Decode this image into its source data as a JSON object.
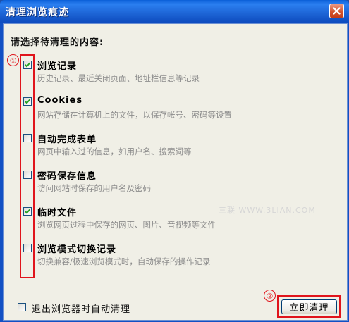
{
  "window": {
    "title": "清理浏览痕迹"
  },
  "heading": "请选择待清理的内容:",
  "items": [
    {
      "title": "浏览记录",
      "desc": "历史记录、最近关闭页面、地址栏信息等记录",
      "checked": true
    },
    {
      "title": "Cookies",
      "desc": "网站存储在计算机上的文件，以保存帐号、密码等设置",
      "checked": true
    },
    {
      "title": "自动完成表单",
      "desc": "网页中输入过的信息，如用户名、搜索词等",
      "checked": false
    },
    {
      "title": "密码保存信息",
      "desc": "访问网站时保存的用户名及密码",
      "checked": false
    },
    {
      "title": "临时文件",
      "desc": "浏览网页过程中保存的网页、图片、音视频等文件",
      "checked": true
    },
    {
      "title": "浏览模式切换记录",
      "desc": "切换兼容/极速浏览模式时，自动保存的操作记录",
      "checked": false
    }
  ],
  "exit_option": {
    "label": "退出浏览器时自动清理",
    "checked": false
  },
  "clean_button": {
    "label": "立即清理"
  },
  "annotations": {
    "one": "①",
    "two": "②"
  },
  "watermark": "三联 WWW.3LIAN.COM",
  "icons": {
    "close": "close-icon",
    "check": "check-icon"
  },
  "colors": {
    "titlebar": "#0d4bbf",
    "client_bg": "#f0efe6",
    "annotation_red": "#e0141c",
    "desc_gray": "#8c8c8c"
  }
}
